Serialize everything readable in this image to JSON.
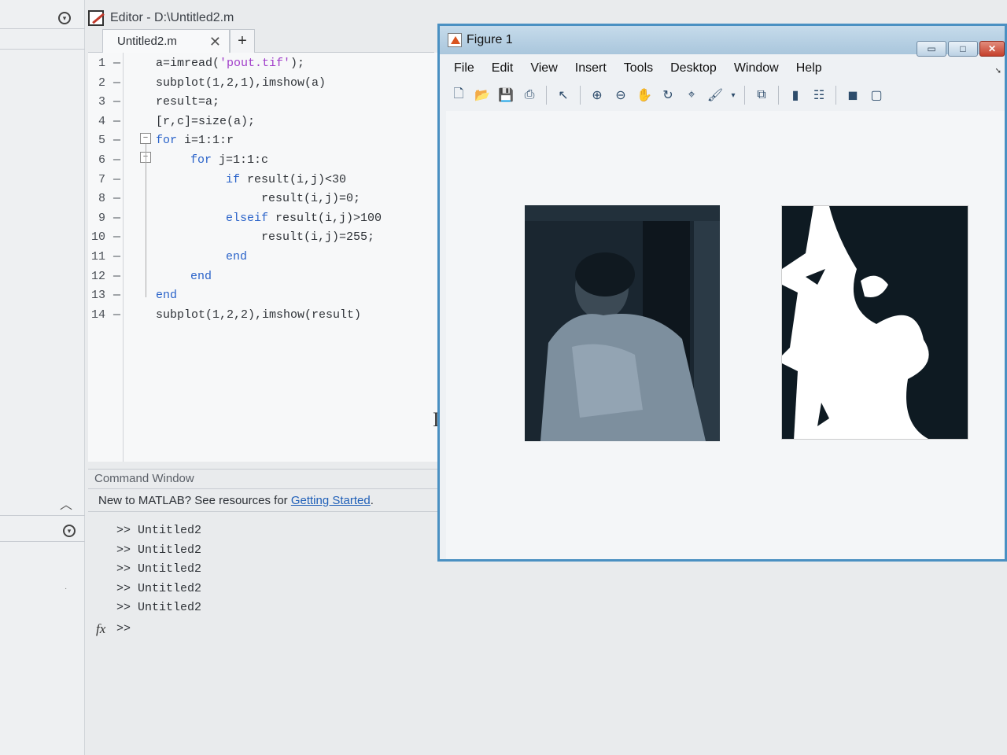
{
  "editor": {
    "title": "Editor - D:\\Untitled2.m",
    "tab_label": "Untitled2.m",
    "tab_close": "✕",
    "tab_add": "+",
    "lines": [
      {
        "n": "1",
        "indent": 0,
        "parts": [
          {
            "t": "a=imread(",
            "c": "code"
          },
          {
            "t": "'pout.tif'",
            "c": "str"
          },
          {
            "t": ");",
            "c": "code"
          }
        ]
      },
      {
        "n": "2",
        "indent": 0,
        "parts": [
          {
            "t": "subplot(1,2,1),imshow(a)",
            "c": "code"
          }
        ]
      },
      {
        "n": "3",
        "indent": 0,
        "parts": [
          {
            "t": "result=a;",
            "c": "code"
          }
        ]
      },
      {
        "n": "4",
        "indent": 0,
        "parts": [
          {
            "t": "[r,c]=size(a);",
            "c": "code"
          }
        ]
      },
      {
        "n": "5",
        "indent": 0,
        "parts": [
          {
            "t": "for",
            "c": "kw"
          },
          {
            "t": " i=1:1:r",
            "c": "code"
          }
        ]
      },
      {
        "n": "6",
        "indent": 1,
        "parts": [
          {
            "t": "for",
            "c": "kw"
          },
          {
            "t": " j=1:1:c",
            "c": "code"
          }
        ]
      },
      {
        "n": "7",
        "indent": 2,
        "parts": [
          {
            "t": "if",
            "c": "kw"
          },
          {
            "t": " result(i,j)<30",
            "c": "code"
          }
        ]
      },
      {
        "n": "8",
        "indent": 3,
        "parts": [
          {
            "t": "result(i,j)=0;",
            "c": "code"
          }
        ]
      },
      {
        "n": "9",
        "indent": 2,
        "parts": [
          {
            "t": "elseif",
            "c": "kw"
          },
          {
            "t": " result(i,j)>100",
            "c": "code"
          }
        ]
      },
      {
        "n": "10",
        "indent": 3,
        "parts": [
          {
            "t": "result(i,j)=255;",
            "c": "code"
          }
        ]
      },
      {
        "n": "11",
        "indent": 2,
        "parts": [
          {
            "t": "end",
            "c": "kw"
          }
        ]
      },
      {
        "n": "12",
        "indent": 1,
        "parts": [
          {
            "t": "end",
            "c": "kw"
          }
        ]
      },
      {
        "n": "13",
        "indent": 0,
        "parts": [
          {
            "t": "end",
            "c": "kw"
          }
        ]
      },
      {
        "n": "14",
        "indent": 0,
        "parts": [
          {
            "t": "subplot(1,2,2),imshow(result)",
            "c": "code"
          }
        ]
      }
    ]
  },
  "command_window": {
    "header": "Command Window",
    "notice_prefix": "New to MATLAB? See resources for ",
    "notice_link": "Getting Started",
    "notice_suffix": ".",
    "history": [
      ">> Untitled2",
      ">> Untitled2",
      ">> Untitled2",
      ">> Untitled2",
      ">> Untitled2"
    ],
    "prompt": ">>",
    "fx": "fx"
  },
  "figure": {
    "title": "Figure 1",
    "menu": [
      "File",
      "Edit",
      "View",
      "Insert",
      "Tools",
      "Desktop",
      "Window",
      "Help"
    ],
    "toolbar_icons": [
      "new-figure-icon",
      "open-file-icon",
      "save-icon",
      "print-icon",
      "pointer-icon",
      "zoom-in-icon",
      "zoom-out-icon",
      "pan-icon",
      "rotate-3d-icon",
      "data-cursor-icon",
      "brush-icon",
      "link-plot-icon",
      "colorbar-icon",
      "legend-icon",
      "hide-plot-tools-icon",
      "show-plot-tools-icon"
    ],
    "window_buttons": {
      "minimize": "▭",
      "maximize": "□",
      "close": "✕"
    }
  }
}
